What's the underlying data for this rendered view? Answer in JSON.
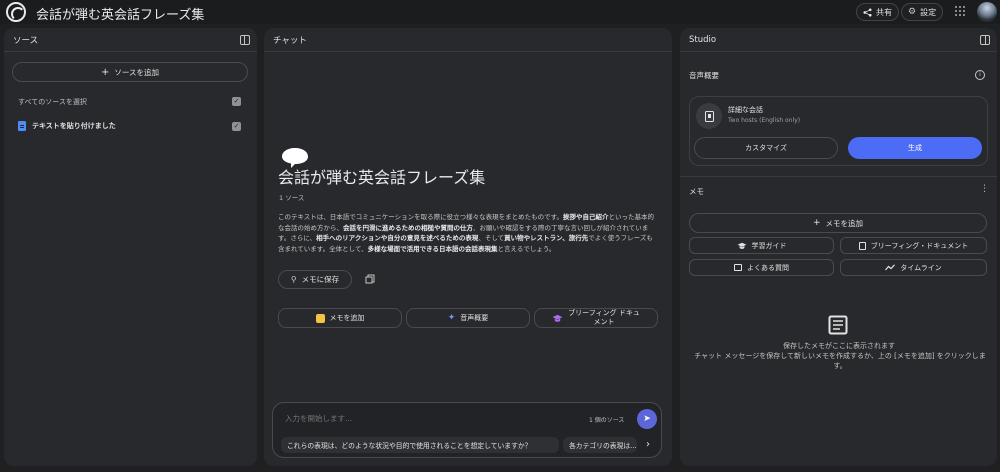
{
  "header": {
    "title": "会話が弾む英会話フレーズ集",
    "share_label": "共有",
    "settings_label": "設定"
  },
  "sources": {
    "title": "ソース",
    "add_label": "ソースを追加",
    "select_all_label": "すべてのソースを選択",
    "items": [
      {
        "label": "テキストを貼り付けました",
        "checked": true
      }
    ]
  },
  "chat": {
    "title": "チャット",
    "notebook_title": "会話が弾む英会話フレーズ集",
    "source_count": "1 ソース",
    "summary_parts": [
      {
        "text": "このテキストは、日本語でコミュニケーションを取る際に役立つ様々な表現をまとめたものです。",
        "bold": false
      },
      {
        "text": "挨拶や自己紹介",
        "bold": true
      },
      {
        "text": "といった基本的な会話の始め方から、",
        "bold": false
      },
      {
        "text": "会話を円滑に進めるための相槌や質問の仕方",
        "bold": true
      },
      {
        "text": "、お願いや確認をする際の丁寧な言い回しが紹介されています。さらに、",
        "bold": false
      },
      {
        "text": "相手へのリアクションや自分の意見を述べるための表現",
        "bold": true
      },
      {
        "text": "、そして",
        "bold": false
      },
      {
        "text": "買い物やレストラン、旅行先",
        "bold": true
      },
      {
        "text": "でよく使うフレーズも含まれています。全体として、",
        "bold": false
      },
      {
        "text": "多様な場面で活用できる日本語の会話表現集",
        "bold": true
      },
      {
        "text": "と言えるでしょう。",
        "bold": false
      }
    ],
    "save_note_label": "メモに保存",
    "actions": [
      {
        "label": "メモを追加",
        "icon": "note-add-icon",
        "color": "#f6c344"
      },
      {
        "label": "音声概要",
        "icon": "sparkle-audio-icon",
        "color": "#7b8cff"
      },
      {
        "label": "ブリーフィング ドキュメント",
        "icon": "graduation-cap-icon",
        "color": "#a86ff2"
      }
    ],
    "input_placeholder": "入力を開始します...",
    "input_source_count": "1 個のソース",
    "suggestions": [
      "これらの表現は、どのような状況や目的で使用されることを想定していますか？",
      "各カテゴリの表現は..."
    ]
  },
  "studio": {
    "title": "Studio",
    "audio_overview": {
      "title": "音声概要",
      "card_title": "詳細な会話",
      "card_subtitle": "Two hosts (English only)",
      "customize_label": "カスタマイズ",
      "generate_label": "生成"
    },
    "notes": {
      "title": "メモ",
      "add_label": "メモを追加",
      "quick_buttons": [
        {
          "label": "学習ガイド",
          "icon": "graduation-cap-icon"
        },
        {
          "label": "ブリーフィング・ドキュメント",
          "icon": "document-icon"
        },
        {
          "label": "よくある質問",
          "icon": "faq-icon"
        },
        {
          "label": "タイムライン",
          "icon": "timeline-icon"
        }
      ],
      "empty_title": "保存したメモがここに表示されます",
      "empty_body": "チャット メッセージを保存して新しいメモを作成するか、上の [メモを追加] をクリックします。"
    }
  },
  "colors": {
    "accent": "#4d6cf6",
    "send": "#5b67d9",
    "doc_icon": "#4c8df6"
  }
}
